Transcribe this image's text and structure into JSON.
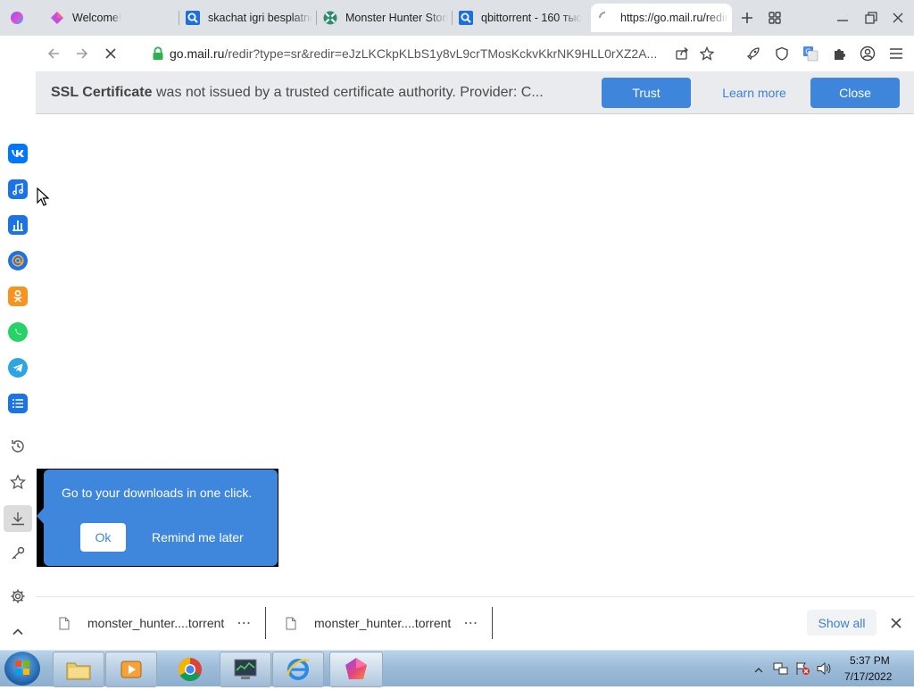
{
  "tabs": [
    {
      "title": "Welcome!",
      "icon": "browser-gem-icon"
    },
    {
      "title": "skachat igri besplatno",
      "icon": "search-icon"
    },
    {
      "title": "Monster Hunter Stories",
      "icon": "globe-icon"
    },
    {
      "title": "qbittorrent - 160 тыс",
      "icon": "search-icon"
    },
    {
      "title": "https://go.mail.ru/redir",
      "icon": "loading-spinner-icon"
    }
  ],
  "address_bar": {
    "host": "go.mail.ru",
    "path": "/redir?type=sr&redir=eJzLKCkpKLbS1y8vL9crTMosKckvKkrNK9HLL0rXZ2A..."
  },
  "infobar": {
    "title": "SSL Certificate",
    "message": "was not issued by a trusted certificate authority. Provider: C...",
    "trust_label": "Trust",
    "learn_more_label": "Learn more",
    "close_label": "Close"
  },
  "popup": {
    "message": "Go to your downloads in one click.",
    "ok_label": "Ok",
    "later_label": "Remind me later"
  },
  "downloads": [
    {
      "name": "monster_hunter....torrent"
    },
    {
      "name": "monster_hunter....torrent"
    }
  ],
  "downloads_show_all": "Show all",
  "clock": {
    "time": "5:37 PM",
    "date": "7/17/2022"
  },
  "colors": {
    "accent": "#3d86dc",
    "tab_strip": "#dee1e6",
    "infobar": "#eaebee"
  }
}
